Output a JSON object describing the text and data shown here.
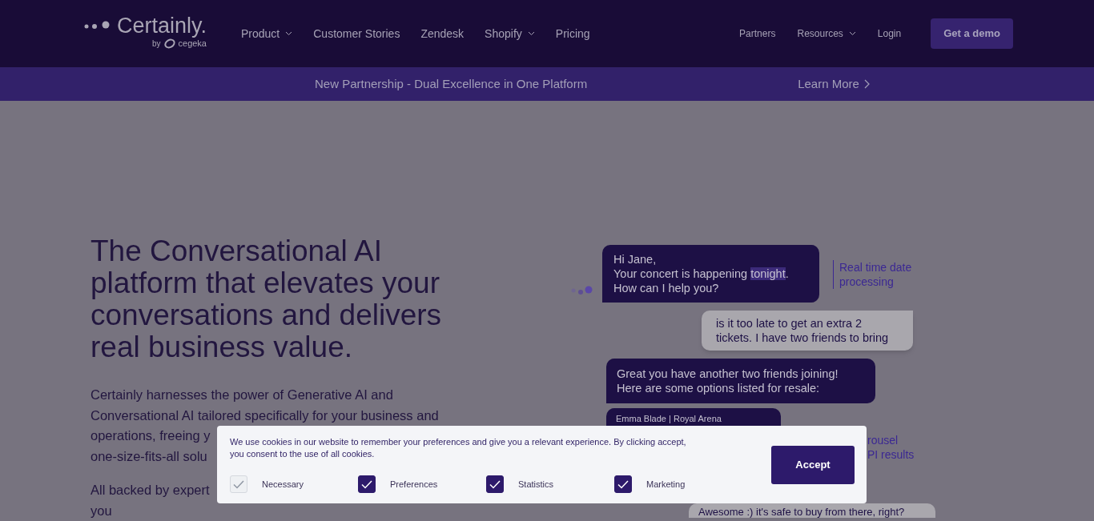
{
  "logo": {
    "name": "Certainly.",
    "by": "by",
    "parent": "cegeka"
  },
  "nav": {
    "main": [
      {
        "label": "Product",
        "has_menu": true
      },
      {
        "label": "Customer Stories",
        "has_menu": false
      },
      {
        "label": "Zendesk",
        "has_menu": false
      },
      {
        "label": "Shopify",
        "has_menu": true
      },
      {
        "label": "Pricing",
        "has_menu": false
      }
    ],
    "secondary": [
      {
        "label": "Partners",
        "has_menu": false
      },
      {
        "label": "Resources",
        "has_menu": true
      },
      {
        "label": "Login",
        "has_menu": false
      }
    ],
    "cta": "Get a demo"
  },
  "announcement": {
    "text": "New Partnership - Dual Excellence in One Platform",
    "link": "Learn More"
  },
  "hero": {
    "heading": "The Conversational AI platform that elevates your conversations and delivers real business value.",
    "paragraphs": [
      [
        "Certainly harnesses the power of Generative AI and",
        "Conversational AI tailored specifically for your business and",
        "operations, freeing y",
        "one-size-fits-all solu"
      ],
      [
        "All backed by expert",
        "you"
      ]
    ]
  },
  "chat": {
    "bot_message_1": {
      "before": "Hi Jane,\nYour concert is happening ",
      "highlight": "tonight",
      "after": ".\nHow can I help you?"
    },
    "annotation_1": "Real time date\nprocessing",
    "user_message_1": "is it too late to get an extra 2\ntickets. I have two friends to bring",
    "bot_message_2": "Great you have another two friends joining!\nHere are some options listed for resale:",
    "card": "Emma Blade | Royal Arena",
    "annotation_2": "rousel\nPI results",
    "user_message_2": "Awesome :) it's safe to buy from there, right?"
  },
  "cookie_banner": {
    "text": "We use cookies in our website to remember your preferences and give you a relevant experience. By clicking accept, you consent to the use of all cookies.",
    "options": [
      {
        "label": "Necessary",
        "checked": true,
        "disabled": true
      },
      {
        "label": "Preferences",
        "checked": true,
        "disabled": false
      },
      {
        "label": "Statistics",
        "checked": true,
        "disabled": false
      },
      {
        "label": "Marketing",
        "checked": true,
        "disabled": false
      }
    ],
    "accept": "Accept"
  }
}
